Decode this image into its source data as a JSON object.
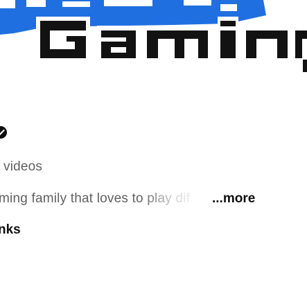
{
  "channel": {
    "banner_logo_text": "Gaming",
    "video_count_label": "videos",
    "description_snippet": "ming family that loves to play dif",
    "more_label": "...more",
    "links_label": "nks"
  },
  "colors": {
    "banner_blue": "#1f6fe0",
    "logo_text": "#121212",
    "secondary_text": "#606060",
    "primary_text": "#0f0f0f",
    "background": "#ffffff"
  },
  "icons": {
    "verified": "verified-check-icon"
  }
}
